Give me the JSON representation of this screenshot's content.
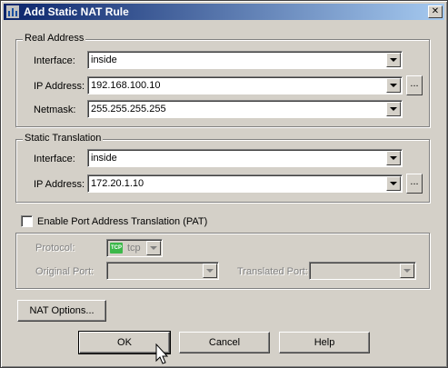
{
  "window": {
    "title": "Add Static NAT Rule",
    "close_glyph": "✕"
  },
  "real_address": {
    "legend": "Real Address",
    "interface_label": "Interface:",
    "interface_value": "inside",
    "ip_label": "IP Address:",
    "ip_value": "192.168.100.10",
    "netmask_label": "Netmask:",
    "netmask_value": "255.255.255.255",
    "browse_label": "..."
  },
  "static_translation": {
    "legend": "Static Translation",
    "interface_label": "Interface:",
    "interface_value": "inside",
    "ip_label": "IP Address:",
    "ip_value": "172.20.1.10",
    "browse_label": "..."
  },
  "pat": {
    "checkbox_label": "Enable Port Address Translation (PAT)",
    "checked": false,
    "protocol_label": "Protocol:",
    "protocol_icon_text": "TCP",
    "protocol_value": "tcp",
    "original_port_label": "Original Port:",
    "original_port_value": "",
    "translated_port_label": "Translated Port:",
    "translated_port_value": ""
  },
  "buttons": {
    "nat_options": "NAT Options...",
    "ok": "OK",
    "cancel": "Cancel",
    "help": "Help"
  },
  "icons": {
    "window_icon": "cisco-app-icon",
    "protocol_icon": "tcp-protocol-icon",
    "pointer": "mouse-pointer-icon"
  },
  "colors": {
    "title_start": "#0a246a",
    "title_end": "#a6caf0",
    "dialog_bg": "#d4d0c8",
    "tcp_badge": "#3cb84a"
  }
}
